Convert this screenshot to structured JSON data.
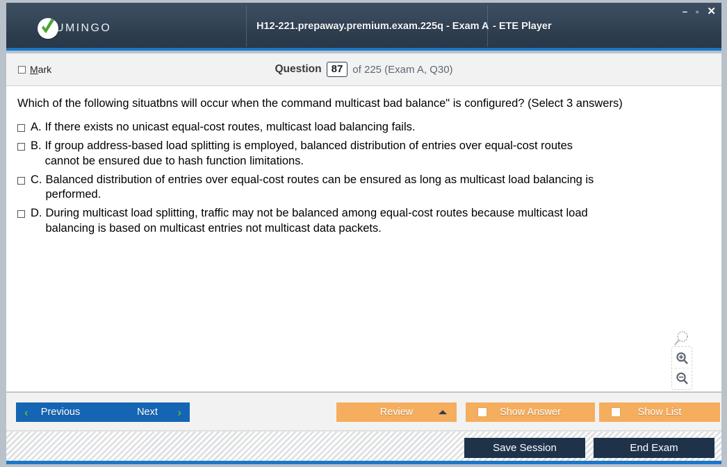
{
  "window": {
    "title_part1": "H12-221.prepaway.premium.exam.225q - Exam A",
    "title_part2": "- ETE Player",
    "minimize_label": "–",
    "maximize_label": "▫",
    "close_label": "✕",
    "logo_text": "UMINGO"
  },
  "header": {
    "mark_label_initial": "M",
    "mark_label_rest": "ark",
    "question_word": "Question",
    "question_number": "87",
    "question_of": "of 225 (Exam A, Q30)"
  },
  "question": {
    "text": "Which of the following situatbns will occur when the command   multicast bad balance\" is configured? (Select 3 answers)",
    "answers": [
      {
        "letter": "A.",
        "line1": "If there exists no unicast equal-cost routes, multicast load balancing fails.",
        "line2": ""
      },
      {
        "letter": "B.",
        "line1": "If group address-based load splitting is employed, balanced distribution of entries over equal-cost routes",
        "line2": "cannot be ensured due to hash function limitations."
      },
      {
        "letter": "C.",
        "line1": "Balanced distribution of entries over equal-cost routes can be ensured as long as multicast load balancing is",
        "line2": "performed."
      },
      {
        "letter": "D.",
        "line1": "During multicast load splitting, traffic may not be balanced among equal-cost routes  because multicast load",
        "line2": "balancing is based on multicast entries not multicast data packets."
      }
    ]
  },
  "toolbar": {
    "previous_label": "Previous",
    "next_label": "Next",
    "prev_chevron": "‹",
    "next_chevron": "›",
    "review_label": "Review",
    "show_answer_label": "Show Answer",
    "show_list_label": "Show List"
  },
  "statusbar": {
    "save_session_label": "Save Session",
    "end_exam_label": "End Exam"
  },
  "colors": {
    "titlebar_dark": "#2c3c4d",
    "accent_blue": "#1b78c8",
    "button_blue": "#1565b5",
    "button_orange": "#f5ad5e",
    "button_dark": "#1e3349",
    "chevron_green": "#6db33f"
  }
}
